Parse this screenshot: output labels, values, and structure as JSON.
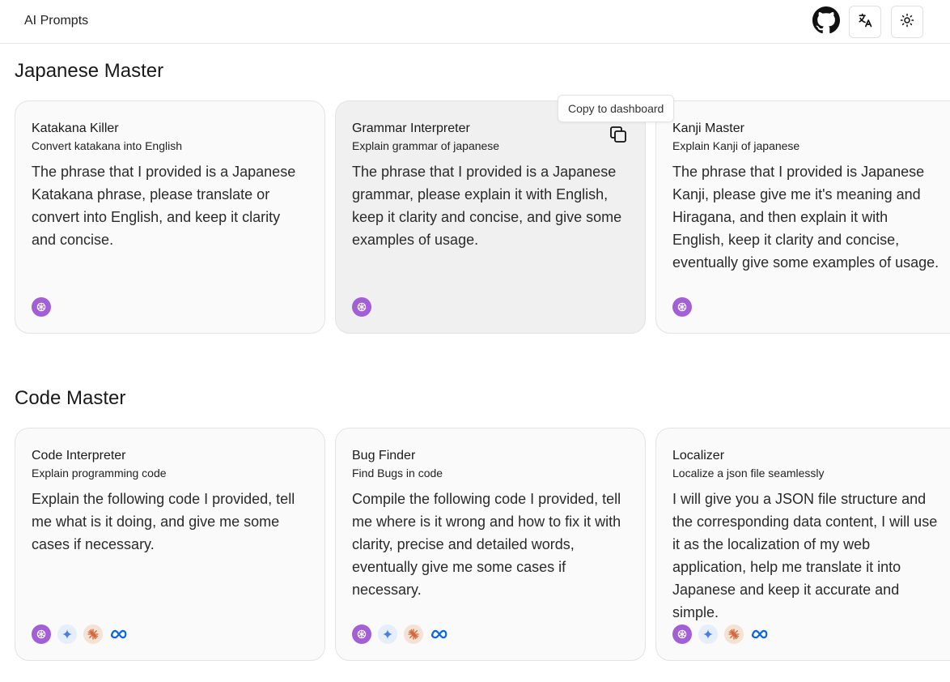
{
  "app": {
    "title": "AI Prompts"
  },
  "header": {
    "github_icon": "github-icon",
    "translate_icon": "translate-icon",
    "theme_icon": "sun-icon"
  },
  "tooltip": {
    "text": "Copy to dashboard"
  },
  "sections": [
    {
      "title": "Japanese Master",
      "cards": [
        {
          "title": "Katakana Killer",
          "subtitle": "Convert katakana into English",
          "body": "The phrase that I provided is a Japanese Katakana phrase, please translate or convert into English, and keep it clarity and concise.",
          "models": [
            "openai-icon"
          ]
        },
        {
          "title": "Grammar Interpreter",
          "subtitle": "Explain grammar of japanese",
          "body": "The phrase that I provided is a Japanese grammar, please explain it with English, keep it clarity and concise, and give some examples of usage.",
          "models": [
            "openai-icon"
          ]
        },
        {
          "title": "Kanji Master",
          "subtitle": "Explain Kanji of japanese",
          "body": "The phrase that I provided is Japanese Kanji, please give me it's meaning and Hiragana, and then explain it with English, keep it clarity and concise, eventually give some examples of usage.",
          "models": [
            "openai-icon"
          ]
        }
      ]
    },
    {
      "title": "Code Master",
      "cards": [
        {
          "title": "Code Interpreter",
          "subtitle": "Explain programming code",
          "body": "Explain the following code I provided, tell me what is it doing, and give me some cases if necessary.",
          "models": [
            "openai-icon",
            "gemini-icon",
            "claude-icon",
            "meta-icon"
          ]
        },
        {
          "title": "Bug Finder",
          "subtitle": "Find Bugs in code",
          "body": "Compile the following code I provided, tell me where is it wrong and how to fix it with clarity, precise and detailed words, eventually give me some cases if necessary.",
          "models": [
            "openai-icon",
            "gemini-icon",
            "claude-icon",
            "meta-icon"
          ]
        },
        {
          "title": "Localizer",
          "subtitle": "Localize a json file seamlessly",
          "body": "I will give you a JSON file structure and the corresponding data content, I will use it as the localization of my web application, help me translate it into Japanese and keep it accurate and simple.",
          "models": [
            "openai-icon",
            "gemini-icon",
            "claude-icon",
            "meta-icon"
          ]
        }
      ]
    }
  ]
}
